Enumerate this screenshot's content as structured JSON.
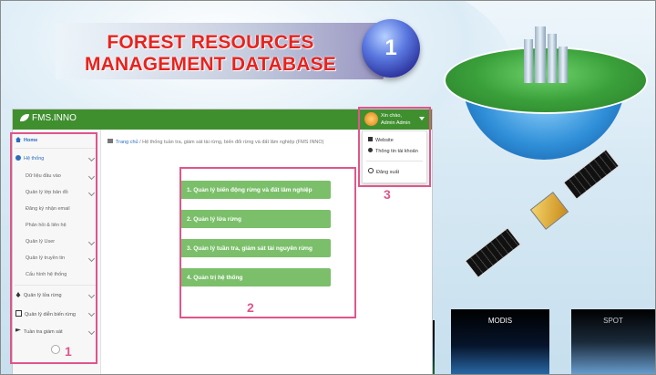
{
  "banner": {
    "title_line1": "FOREST RESOURCES",
    "title_line2": "MANAGEMENT DATABASE",
    "badge": "1"
  },
  "app": {
    "brand": "FMS.INNO",
    "user": {
      "greeting": "Xin chào,",
      "name": "Admin Admin"
    },
    "dropdown": {
      "website": "Website",
      "account": "Thông tin tài khoản",
      "logout": "Đăng xuất"
    },
    "breadcrumb": {
      "home": "Trang chủ",
      "separator": "/",
      "current": "Hệ thống tuần tra, giám sát tài rừng, biến đổi rừng và đất lâm nghiệp (FMS INNO)"
    },
    "sidebar": {
      "home": "Home",
      "system": "Hệ thống",
      "sub_items": [
        "Dữ liệu đầu vào",
        "Quản lý lớp bản đồ",
        "Đăng ký nhận email",
        "Phản hồi & liên hệ",
        "Quản lý User",
        "Quản lý truyền tin",
        "Cấu hình hệ thống"
      ],
      "forest_fire": "Quản lý lửa rừng",
      "forest_change": "Quản lý diễn biến rừng",
      "patrol": "Tuần tra giám sát"
    },
    "menu": [
      "1. Quản lý biến động rừng và đất lâm nghiệp",
      "2. Quản lý lửa rừng",
      "3. Quản lý tuần tra, giám sát tài nguyên rừng",
      "4. Quản trị hệ thống"
    ]
  },
  "annotations": {
    "a1": "1",
    "a2": "2",
    "a3": "3"
  },
  "thumbnails": {
    "modis": "MODIS",
    "spot": "SPOT"
  },
  "colors": {
    "topbar": "#3f8f2f",
    "menu_button": "#7bbf6a",
    "annotation": "#e0558a",
    "title": "#e8231e"
  }
}
